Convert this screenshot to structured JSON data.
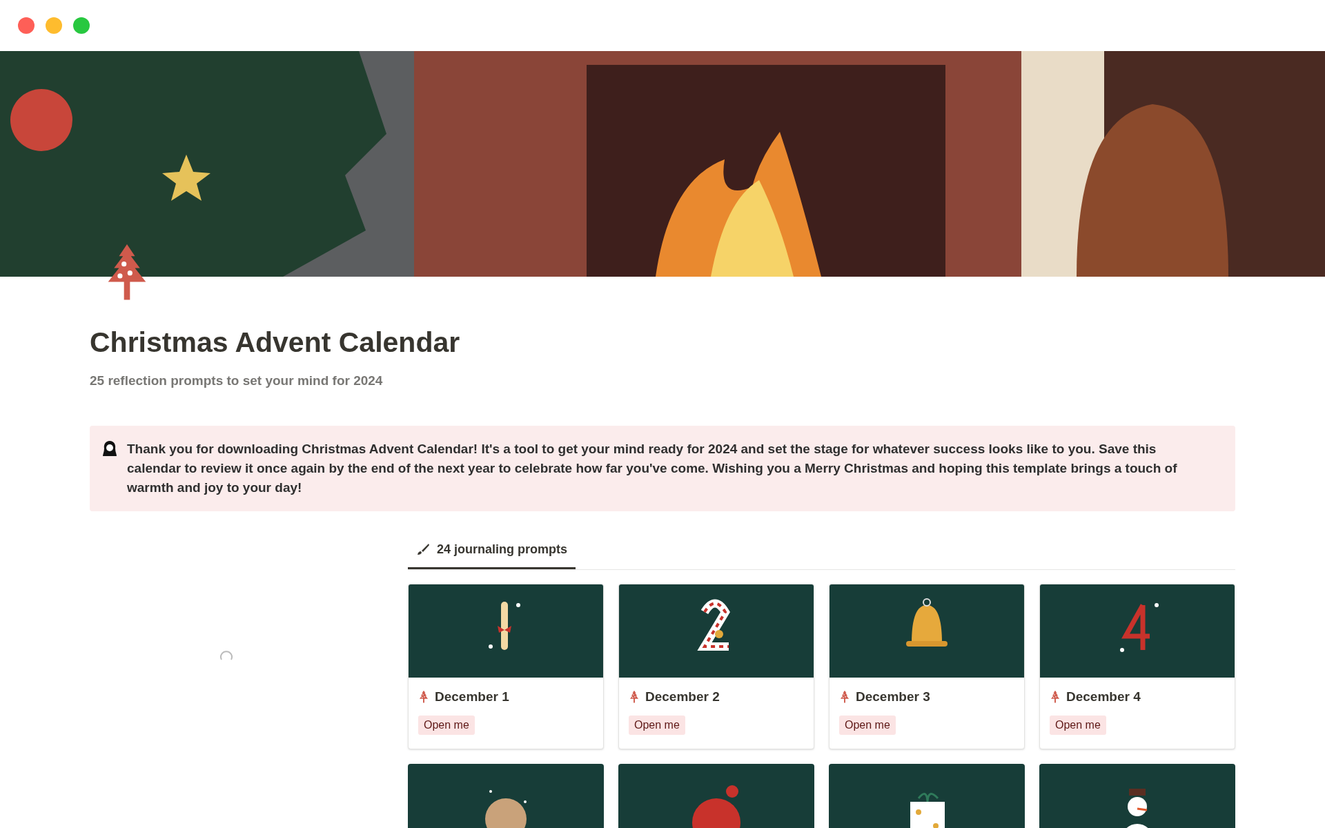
{
  "title": "Christmas Advent Calendar",
  "subtitle": "25 reflection prompts to set your mind for 2024",
  "callout": "Thank you for downloading Christmas Advent Calendar! It's a tool to get your mind ready for 2024 and set the stage for whatever success looks like to you. Save this calendar to review it once again by the end of the next year to celebrate how far you've come. Wishing you a Merry Christmas and hoping this template brings a touch of warmth and joy to your day!",
  "tabs": [
    {
      "label": "24 journaling prompts",
      "selected": true
    }
  ],
  "cards": [
    {
      "title": "December 1",
      "tag": "Open me"
    },
    {
      "title": "December 2",
      "tag": "Open me"
    },
    {
      "title": "December 3",
      "tag": "Open me"
    },
    {
      "title": "December 4",
      "tag": "Open me"
    }
  ]
}
